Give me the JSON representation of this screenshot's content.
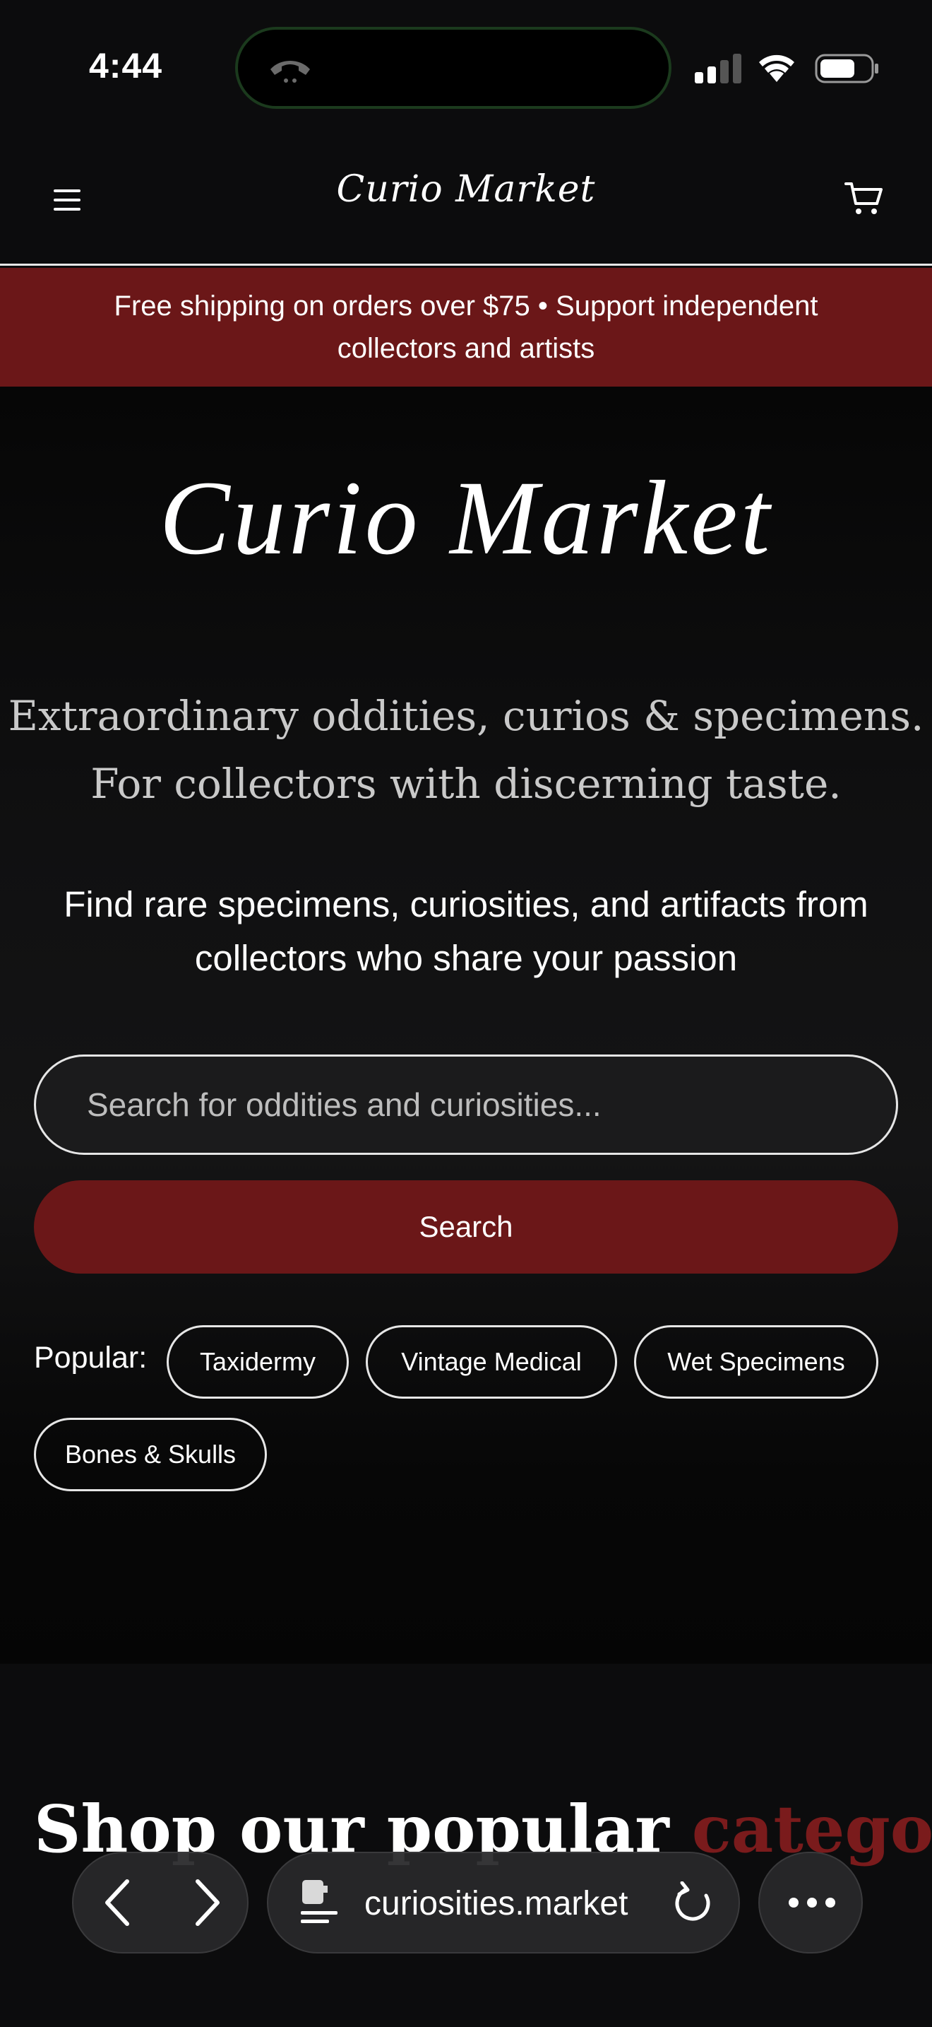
{
  "status_bar": {
    "time": "4:44"
  },
  "header": {
    "logo": "Curio Market"
  },
  "promo": {
    "text": "Free shipping on orders over $75 • Support independent collectors and artists"
  },
  "hero": {
    "logo": "Curio Market",
    "tagline_line1": "Extraordinary oddities, curios & specimens.",
    "tagline_line2": "For collectors with discerning taste.",
    "subtitle": "Find rare specimens, curiosities, and artifacts from collectors who share your passion",
    "search_placeholder": "Search for oddities and curiosities...",
    "search_button": "Search",
    "popular_label": "Popular:",
    "popular_tags": [
      "Taxidermy",
      "Vintage Medical",
      "Wet Specimens",
      "Bones & Skulls"
    ]
  },
  "categories": {
    "heading_main": "Shop our popular ",
    "heading_accent": "categories"
  },
  "browser": {
    "url": "curiosities.market"
  },
  "colors": {
    "accent": "#6b1718",
    "background": "#0c0c0d"
  }
}
